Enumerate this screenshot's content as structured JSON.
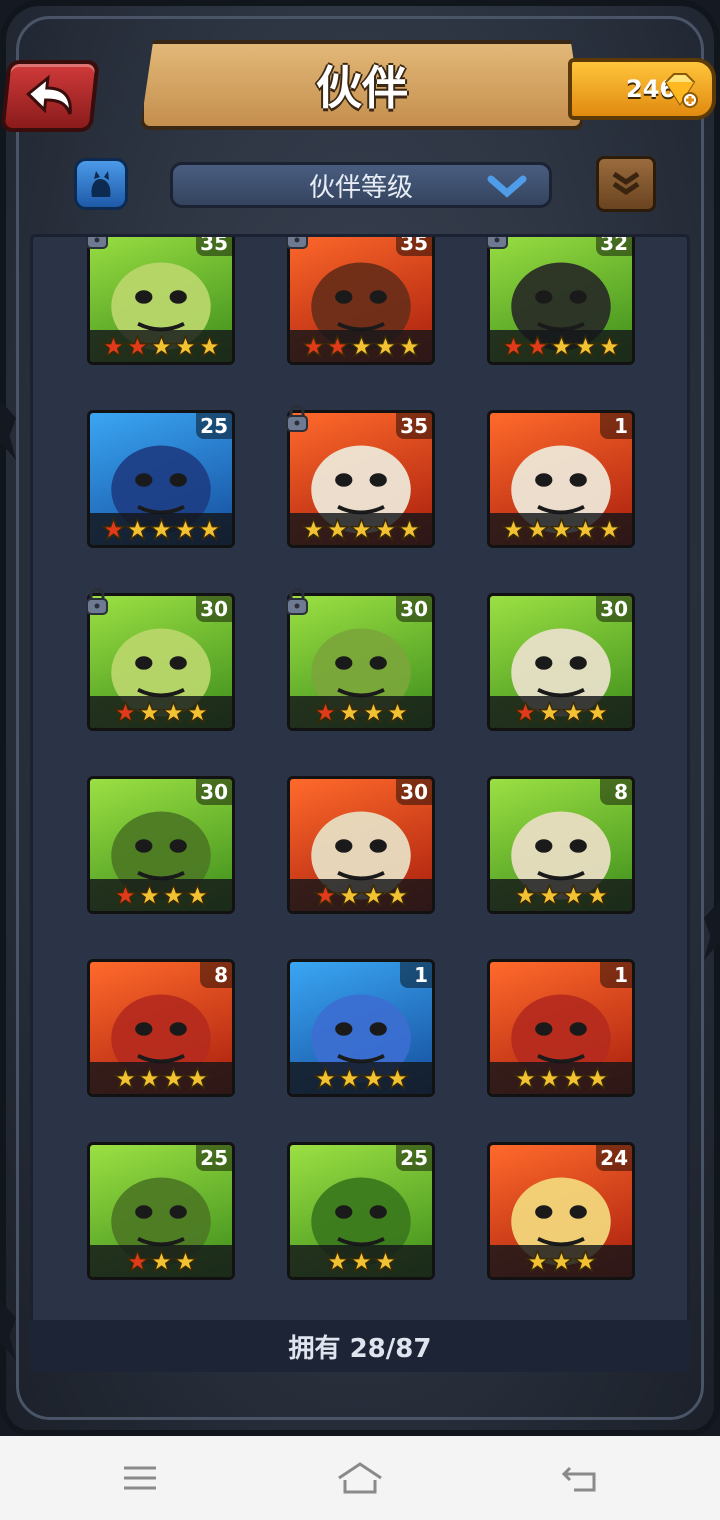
{
  "header": {
    "title": "伙伴",
    "gems": "246"
  },
  "toolbar": {
    "sort_label": "伙伴等级"
  },
  "footer": {
    "owned_text": "拥有 28/87"
  },
  "colors": {
    "star_gold": "#f2c232",
    "star_red": "#e03a1a",
    "green_bg": "#5db52a",
    "red_bg": "#e04a1c",
    "blue_bg": "#2a7ad0"
  },
  "partners": [
    {
      "level": "35",
      "bg": "green",
      "stars": 5,
      "red_stars": 2,
      "locked": true,
      "creature": "green-cyclops-icon"
    },
    {
      "level": "35",
      "bg": "red",
      "stars": 5,
      "red_stars": 2,
      "locked": true,
      "creature": "warrior-woman-icon"
    },
    {
      "level": "32",
      "bg": "green",
      "stars": 5,
      "red_stars": 2,
      "locked": true,
      "creature": "ranger-man-icon"
    },
    {
      "level": "25",
      "bg": "blue",
      "stars": 5,
      "red_stars": 1,
      "locked": false,
      "creature": "hooded-mage-icon"
    },
    {
      "level": "35",
      "bg": "red",
      "stars": 5,
      "red_stars": 0,
      "locked": true,
      "creature": "panda-icon"
    },
    {
      "level": "1",
      "bg": "red",
      "stars": 5,
      "red_stars": 0,
      "locked": false,
      "creature": "panda-icon"
    },
    {
      "level": "30",
      "bg": "green",
      "stars": 4,
      "red_stars": 1,
      "locked": true,
      "creature": "green-cyclops-icon"
    },
    {
      "level": "30",
      "bg": "green",
      "stars": 4,
      "red_stars": 1,
      "locked": true,
      "creature": "goblin-witch-icon"
    },
    {
      "level": "30",
      "bg": "green",
      "stars": 4,
      "red_stars": 1,
      "locked": false,
      "creature": "armored-beast-icon"
    },
    {
      "level": "30",
      "bg": "green",
      "stars": 4,
      "red_stars": 1,
      "locked": false,
      "creature": "boar-orc-icon"
    },
    {
      "level": "30",
      "bg": "red",
      "stars": 4,
      "red_stars": 1,
      "locked": false,
      "creature": "skull-totem-icon"
    },
    {
      "level": "8",
      "bg": "green",
      "stars": 4,
      "red_stars": 0,
      "locked": false,
      "creature": "skull-totem-icon"
    },
    {
      "level": "8",
      "bg": "red",
      "stars": 4,
      "red_stars": 0,
      "locked": false,
      "creature": "goblin-hat-icon"
    },
    {
      "level": "1",
      "bg": "blue",
      "stars": 4,
      "red_stars": 0,
      "locked": false,
      "creature": "blue-troll-icon"
    },
    {
      "level": "1",
      "bg": "red",
      "stars": 4,
      "red_stars": 0,
      "locked": false,
      "creature": "goblin-hat-icon"
    },
    {
      "level": "25",
      "bg": "green",
      "stars": 3,
      "red_stars": 1,
      "locked": false,
      "creature": "boar-orc-icon"
    },
    {
      "level": "25",
      "bg": "green",
      "stars": 3,
      "red_stars": 0,
      "locked": false,
      "creature": "crocodile-icon"
    },
    {
      "level": "24",
      "bg": "red",
      "stars": 3,
      "red_stars": 0,
      "locked": false,
      "creature": "blonde-woman-icon"
    }
  ]
}
